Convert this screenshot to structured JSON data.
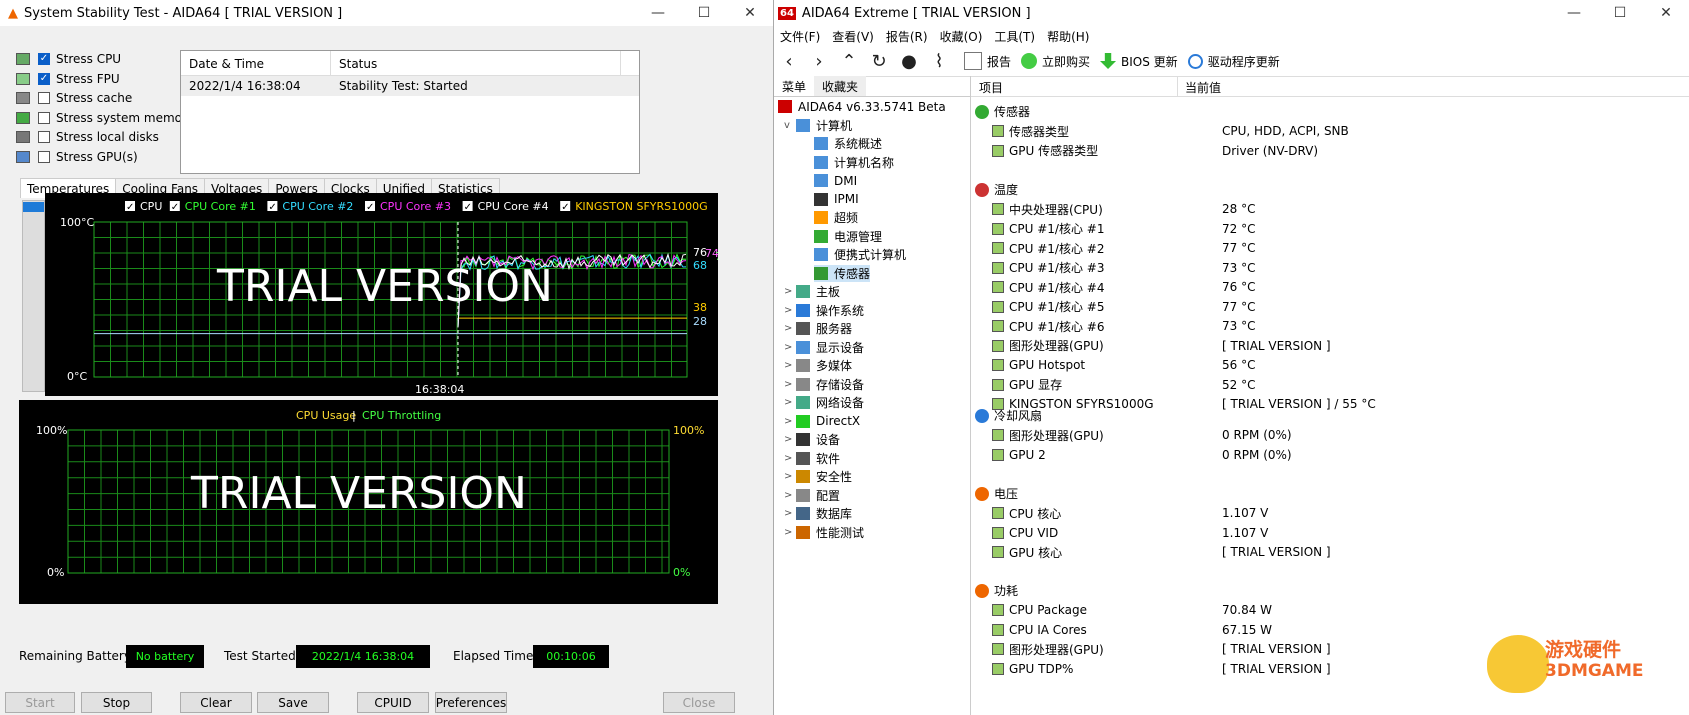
{
  "left_window": {
    "title": "System Stability Test - AIDA64  [ TRIAL VERSION ]",
    "stress": [
      {
        "label": "Stress CPU",
        "checked": true
      },
      {
        "label": "Stress FPU",
        "checked": true
      },
      {
        "label": "Stress cache",
        "checked": false
      },
      {
        "label": "Stress system memory",
        "checked": false
      },
      {
        "label": "Stress local disks",
        "checked": false
      },
      {
        "label": "Stress GPU(s)",
        "checked": false
      }
    ],
    "log": {
      "headers": [
        "Date & Time",
        "Status"
      ],
      "rows": [
        [
          "2022/1/4 16:38:04",
          "Stability Test: Started"
        ]
      ]
    },
    "tabs": [
      "Temperatures",
      "Cooling Fans",
      "Voltages",
      "Powers",
      "Clocks",
      "Unified",
      "Statistics"
    ],
    "temp_chart": {
      "legend": [
        {
          "label": "CPU",
          "color": "#ffffff"
        },
        {
          "label": "CPU Core #1",
          "color": "#33ff33"
        },
        {
          "label": "CPU Core #2",
          "color": "#33ddff"
        },
        {
          "label": "CPU Core #3",
          "color": "#ff33ff"
        },
        {
          "label": "CPU Core #4",
          "color": "#ffffff"
        },
        {
          "label": "KINGSTON SFYRS1000G",
          "color": "#ffcc00"
        }
      ],
      "y_top": "100°C",
      "y_bottom": "0°C",
      "x_label": "16:38:04",
      "watermark": "TRIAL VERSION",
      "right_values": [
        {
          "text": "76",
          "color": "#ffffff"
        },
        {
          "text": "74",
          "color": "#ff66ff"
        },
        {
          "text": "72",
          "color": "#66ff66"
        },
        {
          "text": "68",
          "color": "#33ddff"
        },
        {
          "text": "38",
          "color": "#ffcc00"
        },
        {
          "text": "28",
          "color": "#aaddff"
        }
      ]
    },
    "usage_chart": {
      "title_a": "CPU Usage",
      "sep": "|",
      "title_b": "CPU Throttling",
      "y_top_left": "100%",
      "y_bottom_left": "0%",
      "y_top_right": "100%",
      "y_bottom_right": "0%",
      "watermark": "TRIAL VERSION"
    },
    "status": {
      "battery_label": "Remaining Battery:",
      "battery_value": "No battery",
      "started_label": "Test Started:",
      "started_value": "2022/1/4 16:38:04",
      "elapsed_label": "Elapsed Time:",
      "elapsed_value": "00:10:06"
    },
    "buttons": {
      "start": "Start",
      "stop": "Stop",
      "clear": "Clear",
      "save": "Save",
      "cpuid": "CPUID",
      "preferences": "Preferences",
      "close": "Close"
    }
  },
  "right_window": {
    "title": "AIDA64 Extreme  [ TRIAL VERSION ]",
    "logo": "64",
    "menu": [
      "文件(F)",
      "查看(V)",
      "报告(R)",
      "收藏(O)",
      "工具(T)",
      "帮助(H)"
    ],
    "toolbar": [
      "报告",
      "立即购买",
      "BIOS 更新",
      "驱动程序更新"
    ],
    "left_tabs": [
      "菜单",
      "收藏夹"
    ],
    "tree": [
      {
        "label": "AIDA64 v6.33.5741 Beta",
        "level": 0,
        "exp": ""
      },
      {
        "label": "计算机",
        "level": 1,
        "exp": "v"
      },
      {
        "label": "系统概述",
        "level": 2,
        "exp": ""
      },
      {
        "label": "计算机名称",
        "level": 2,
        "exp": ""
      },
      {
        "label": "DMI",
        "level": 2,
        "exp": ""
      },
      {
        "label": "IPMI",
        "level": 2,
        "exp": ""
      },
      {
        "label": "超频",
        "level": 2,
        "exp": ""
      },
      {
        "label": "电源管理",
        "level": 2,
        "exp": ""
      },
      {
        "label": "便携式计算机",
        "level": 2,
        "exp": ""
      },
      {
        "label": "传感器",
        "level": 2,
        "exp": ""
      },
      {
        "label": "主板",
        "level": 1,
        "exp": ">"
      },
      {
        "label": "操作系统",
        "level": 1,
        "exp": ">"
      },
      {
        "label": "服务器",
        "level": 1,
        "exp": ">"
      },
      {
        "label": "显示设备",
        "level": 1,
        "exp": ">"
      },
      {
        "label": "多媒体",
        "level": 1,
        "exp": ">"
      },
      {
        "label": "存储设备",
        "level": 1,
        "exp": ">"
      },
      {
        "label": "网络设备",
        "level": 1,
        "exp": ">"
      },
      {
        "label": "DirectX",
        "level": 1,
        "exp": ">"
      },
      {
        "label": "设备",
        "level": 1,
        "exp": ">"
      },
      {
        "label": "软件",
        "level": 1,
        "exp": ">"
      },
      {
        "label": "安全性",
        "level": 1,
        "exp": ">"
      },
      {
        "label": "配置",
        "level": 1,
        "exp": ">"
      },
      {
        "label": "数据库",
        "level": 1,
        "exp": ">"
      },
      {
        "label": "性能测试",
        "level": 1,
        "exp": ">"
      }
    ],
    "col_headers": [
      "项目",
      "当前值"
    ],
    "sections": [
      {
        "title": "传感器",
        "items": [
          {
            "k": "传感器类型",
            "v": "CPU, HDD, ACPI, SNB"
          },
          {
            "k": "GPU 传感器类型",
            "v": "Driver  (NV-DRV)"
          }
        ]
      },
      {
        "title": "温度",
        "items": [
          {
            "k": "中央处理器(CPU)",
            "v": "28 °C"
          },
          {
            "k": "CPU #1/核心 #1",
            "v": "72 °C"
          },
          {
            "k": "CPU #1/核心 #2",
            "v": "77 °C"
          },
          {
            "k": "CPU #1/核心 #3",
            "v": "73 °C"
          },
          {
            "k": "CPU #1/核心 #4",
            "v": "76 °C"
          },
          {
            "k": "CPU #1/核心 #5",
            "v": "77 °C"
          },
          {
            "k": "CPU #1/核心 #6",
            "v": "73 °C"
          },
          {
            "k": "图形处理器(GPU)",
            "v": "[ TRIAL VERSION ]"
          },
          {
            "k": "GPU Hotspot",
            "v": "56 °C"
          },
          {
            "k": "GPU 显存",
            "v": "52 °C"
          },
          {
            "k": "KINGSTON SFYRS1000G",
            "v": "[ TRIAL VERSION ] / 55 °C"
          }
        ]
      },
      {
        "title": "冷却风扇",
        "items": [
          {
            "k": "图形处理器(GPU)",
            "v": "0 RPM  (0%)"
          },
          {
            "k": "GPU 2",
            "v": "0 RPM  (0%)"
          }
        ]
      },
      {
        "title": "电压",
        "items": [
          {
            "k": "CPU 核心",
            "v": "1.107 V"
          },
          {
            "k": "CPU VID",
            "v": "1.107 V"
          },
          {
            "k": "GPU 核心",
            "v": "[ TRIAL VERSION ]"
          }
        ]
      },
      {
        "title": "功耗",
        "items": [
          {
            "k": "CPU Package",
            "v": "70.84 W"
          },
          {
            "k": "CPU IA Cores",
            "v": "67.15 W"
          },
          {
            "k": "图形处理器(GPU)",
            "v": "[ TRIAL VERSION ]"
          },
          {
            "k": "GPU TDP%",
            "v": "[ TRIAL VERSION ]"
          }
        ]
      }
    ]
  },
  "watermark_logo": {
    "cn": "游戏硬件",
    "en": "3DMGAME"
  }
}
